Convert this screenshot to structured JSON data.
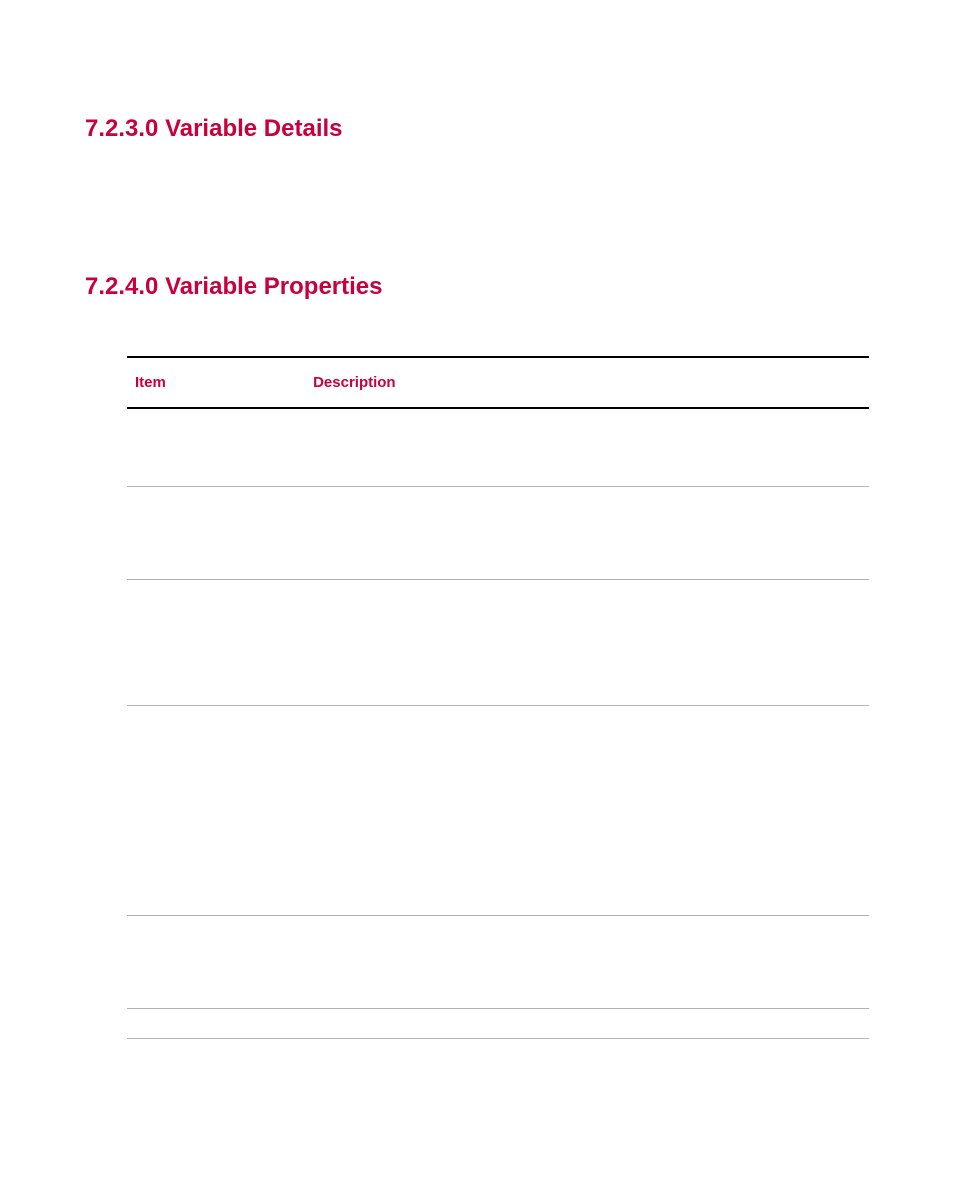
{
  "sections": {
    "variable_details": {
      "heading": "7.2.3.0 Variable Details"
    },
    "variable_properties": {
      "heading": "7.2.4.0 Variable Properties",
      "table": {
        "columns": {
          "item": "Item",
          "description": "Description"
        },
        "rows": [
          {
            "item": "",
            "description": ""
          },
          {
            "item": "",
            "description": ""
          },
          {
            "item": "",
            "description": ""
          },
          {
            "item": "",
            "description": ""
          },
          {
            "item": "",
            "description": ""
          },
          {
            "item": "",
            "description": ""
          }
        ]
      }
    }
  },
  "colors": {
    "accent": "#c8003c",
    "rule_major": "#000000",
    "rule_minor": "#b3b3b3"
  }
}
